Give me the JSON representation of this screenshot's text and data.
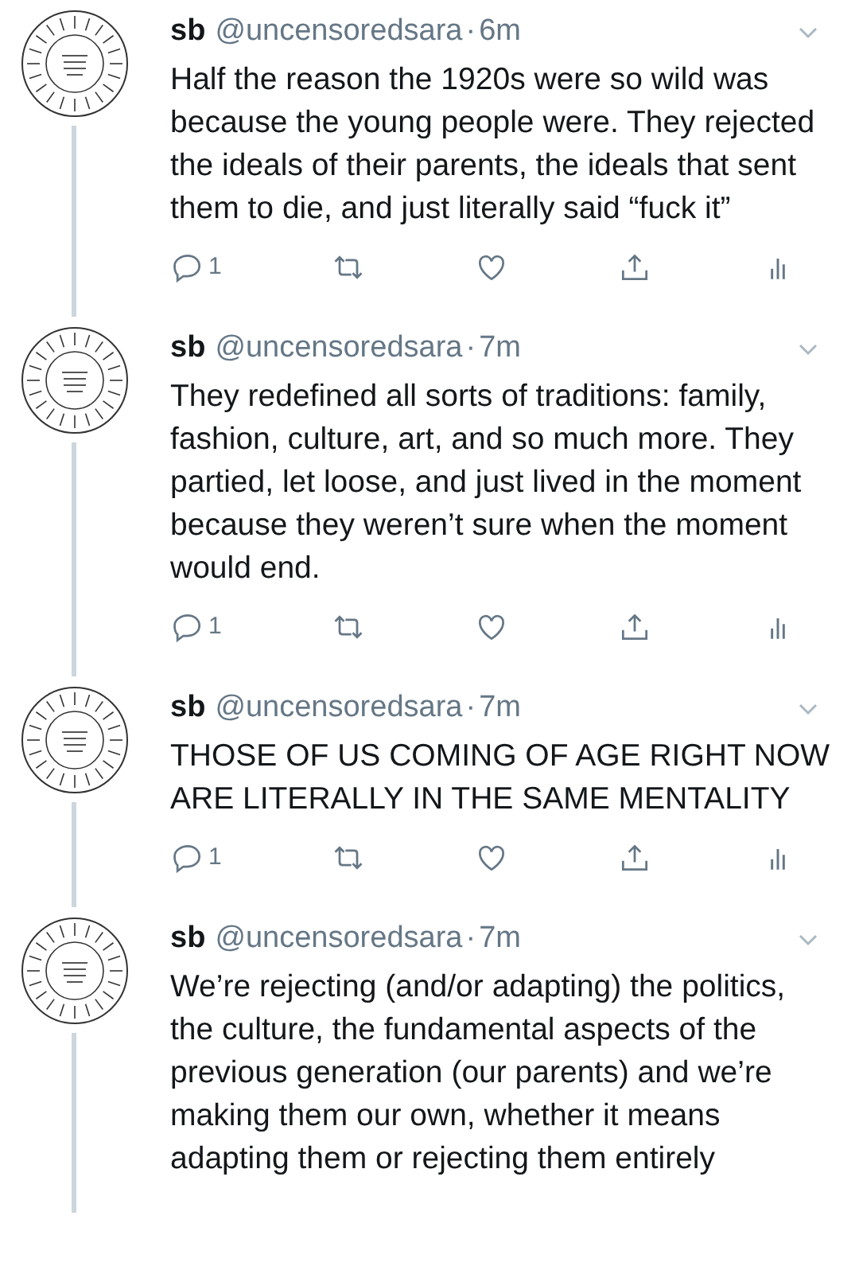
{
  "tweets": [
    {
      "name": "sb",
      "handle": "@uncensoredsara",
      "time": "6m",
      "text": "Half the reason the 1920s were so wild was because the young people were. They rejected the ideals of their parents, the ideals that sent them to die, and just literally said “fuck it”",
      "reply_count": "1"
    },
    {
      "name": "sb",
      "handle": "@uncensoredsara",
      "time": "7m",
      "text": "They redefined all sorts of traditions: family, fashion, culture, art, and so much more. They partied, let loose, and just lived in the moment because they weren’t sure when the moment would end.",
      "reply_count": "1"
    },
    {
      "name": "sb",
      "handle": "@uncensoredsara",
      "time": "7m",
      "text": "THOSE OF US COMING OF AGE RIGHT NOW ARE LITERALLY IN THE SAME MENTALITY",
      "reply_count": "1"
    },
    {
      "name": "sb",
      "handle": "@uncensoredsara",
      "time": "7m",
      "text": "We’re rejecting (and/or adapting) the politics, the culture, the fundamental aspects of the previous generation (our parents) and we’re making them our own, whether it means adapting them or rejecting them entirely"
    }
  ],
  "separator": "·"
}
